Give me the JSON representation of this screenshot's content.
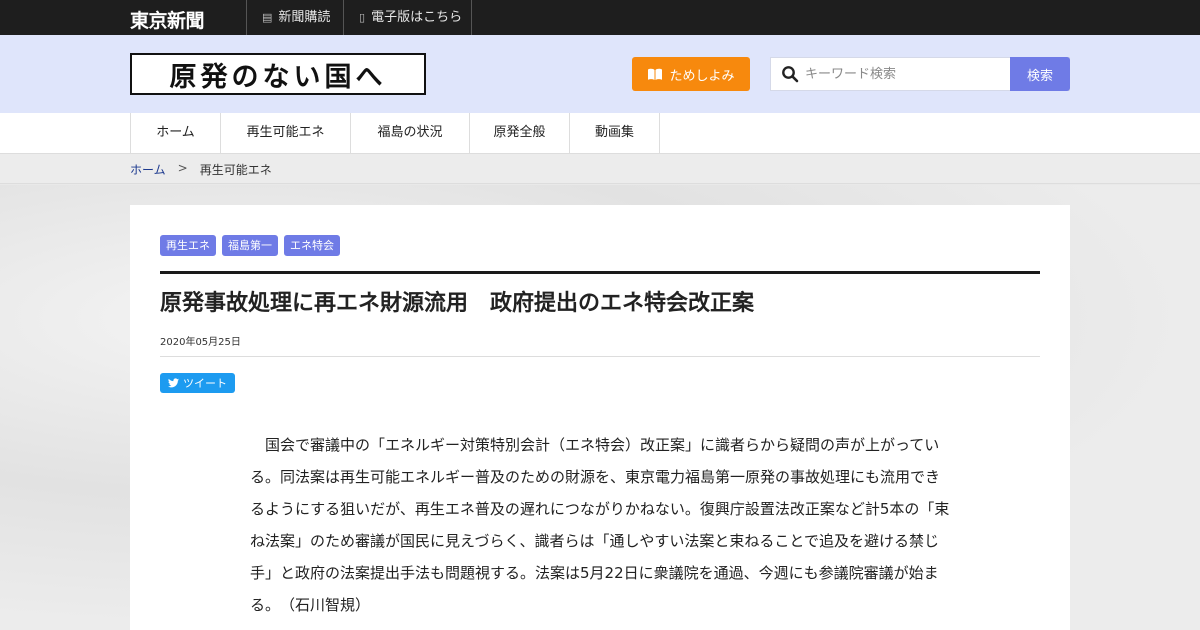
{
  "topbar": {
    "logo": "東京新聞",
    "links": [
      {
        "label": "新聞購読",
        "icon": "newspaper-icon"
      },
      {
        "label": "電子版はこちら",
        "icon": "smartphone-icon"
      }
    ]
  },
  "header": {
    "site_title": "原発のない国へ",
    "trial_button": "ためしよみ",
    "search": {
      "placeholder": "キーワード検索",
      "button": "検索"
    }
  },
  "nav": {
    "items": [
      "ホーム",
      "再生可能エネ",
      "福島の状況",
      "原発全般",
      "動画集"
    ]
  },
  "breadcrumb": {
    "home": "ホーム",
    "separator": ">",
    "current": "再生可能エネ"
  },
  "article": {
    "tags": [
      "再生エネ",
      "福島第一",
      "エネ特会"
    ],
    "headline": "原発事故処理に再エネ財源流用　政府提出のエネ特会改正案",
    "date": "2020年05月25日",
    "tweet_label": "ツイート",
    "body": "国会で審議中の「エネルギー対策特別会計（エネ特会）改正案」に識者らから疑問の声が上がっている。同法案は再生可能エネルギー普及のための財源を、東京電力福島第一原発の事故処理にも流用できるようにする狙いだが、再生エネ普及の遅れにつながりかねない。復興庁設置法改正案など計5本の「束ね法案」のため審議が国民に見えづらく、識者らは「通しやすい法案と束ねることで追及を避ける禁じ手」と政府の法案提出手法も問題視する。法案は5月22日に衆議院を通過、今週にも参議院審議が始まる。　（石川智規）"
  },
  "colors": {
    "topbar": "#1e1e1e",
    "header_bg": "#dfe5fb",
    "accent": "#6f7be6",
    "trial": "#f7890d",
    "twitter": "#1d9bf0"
  }
}
